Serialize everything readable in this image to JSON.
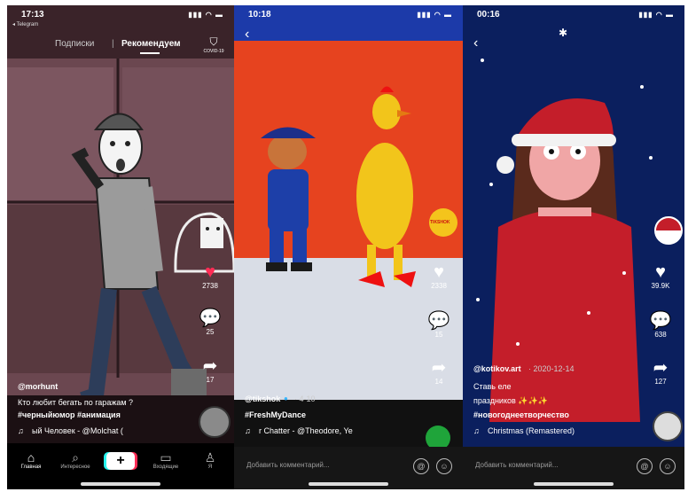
{
  "phone1": {
    "time": "17:13",
    "back_app": "◂ Telegram",
    "tab_following": "Подписки",
    "tab_recommended": "Рекомендуем",
    "covid_label": "COVID-19",
    "likes": "2738",
    "comments": "25",
    "shares": "17",
    "username": "@morhunt",
    "caption": "Кто любит бегать по гаражам ?",
    "hashtags": "#черныйюмор #анимация",
    "music": "ый Человек - @Molchat (",
    "nav": [
      "Главная",
      "Интересное",
      "",
      "Входящие",
      "Я"
    ]
  },
  "phone2": {
    "time": "10:18",
    "brand_sticker": "TIKSHOK",
    "likes": "2338",
    "comments": "15",
    "shares": "14",
    "username": "@tikshok",
    "date": "· 4-10",
    "hashtag": "#FreshMyDance",
    "music": "r Chatter - @Theodore, Ye",
    "comment_placeholder": "Добавить комментарий..."
  },
  "phone3": {
    "time": "00:16",
    "likes": "39.9K",
    "comments": "638",
    "shares": "127",
    "username": "@kotikov.art",
    "date": "· 2020-12-14",
    "caption_line1": "Ставь еле",
    "caption_line2": "праздников ✨✨✨",
    "hashtag": "#новогоднеетворчество",
    "music": "Christmas (Remastered)",
    "comment_placeholder": "Добавить комментарий..."
  },
  "colors": {
    "accent_red": "#fe2c55",
    "phone2_header": "#1c3aa9",
    "phone3_bg": "#0b1f5e"
  }
}
